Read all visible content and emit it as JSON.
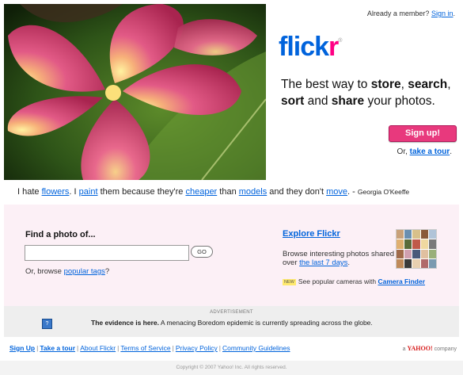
{
  "header": {
    "already_member": "Already a member?",
    "sign_in": "Sign in",
    "logo_a": "flick",
    "logo_b": "r",
    "logo_tm": "®",
    "tagline_1": "The best way to ",
    "tagline_store": "store",
    "tagline_2": ", ",
    "tagline_search": "search",
    "tagline_3": ",",
    "tagline_sort": "sort",
    "tagline_4": " and ",
    "tagline_share": "share",
    "tagline_5": " your photos.",
    "signup": "Sign up!",
    "or_prefix": "Or, ",
    "take_tour": "take a tour",
    "tour_suffix": "."
  },
  "quote": {
    "t1": "I hate ",
    "flowers": "flowers",
    "t2": ". I ",
    "paint": "paint",
    "t3": " them because they're ",
    "cheaper": "cheaper",
    "t4": " than ",
    "models": "models",
    "t5": " and they don't ",
    "move": "move",
    "t6": ". - ",
    "author": "Georgia O'Keeffe"
  },
  "find": {
    "title": "Find a photo of...",
    "input_value": "",
    "go": "GO",
    "browse_prefix": "Or, browse ",
    "popular_tags": "popular tags",
    "browse_suffix": "?"
  },
  "explore": {
    "title": "Explore Flickr",
    "desc_1": "Browse interesting photos shared over ",
    "last7": "the last 7 days",
    "desc_2": ".",
    "new_badge": "NEW",
    "cameras_text": "See popular cameras with ",
    "camera_finder": "Camera Finder"
  },
  "ad": {
    "label": "ADVERTISEMENT",
    "icon": "?",
    "bold": "The evidence is here.",
    "text": "  A menacing Boredom epidemic is currently spreading across the globe."
  },
  "footer": {
    "links": [
      "Sign Up",
      "Take a tour",
      "About Flickr",
      "Terms of Service",
      "Privacy Policy",
      "Community Guidelines"
    ],
    "sep": "|",
    "yahoo_prefix": "a ",
    "yahoo": "YAHOO!",
    "yahoo_suffix": " company",
    "copyright": "Copyright © 2007 Yahoo! Inc. All rights reserved."
  },
  "colors": {
    "link": "#0063dc",
    "brand_pink": "#ff0084",
    "signup_bg": "#e8397d",
    "pink_panel": "#fcf0f6"
  }
}
